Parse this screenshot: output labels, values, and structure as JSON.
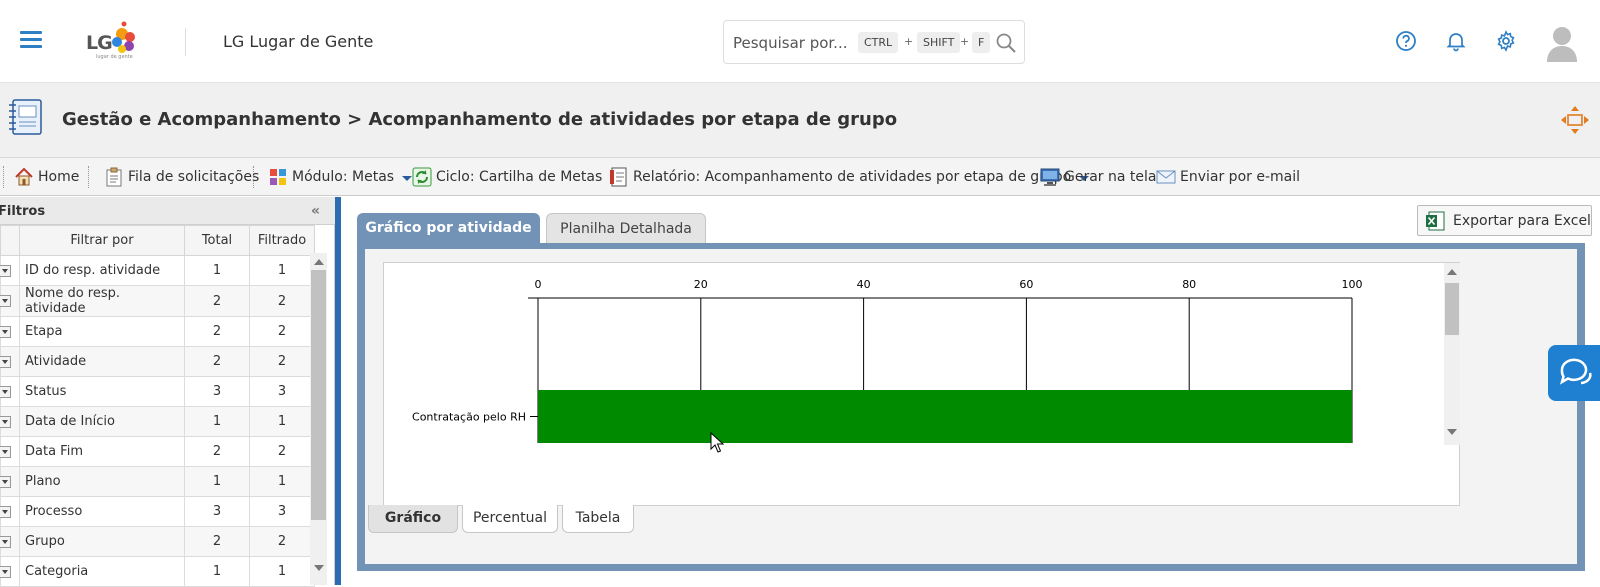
{
  "header": {
    "logo_text": "LG",
    "logo_tagline": "lugar de gente",
    "app_title": "LG Lugar de Gente",
    "search": {
      "placeholder": "Pesquisar por...",
      "keys": [
        "CTRL",
        "SHIFT",
        "F"
      ],
      "plus": "+"
    },
    "icons": [
      "help-icon",
      "bell-icon",
      "gear-icon",
      "user-avatar-icon"
    ],
    "accent_color": "#2e7fc4"
  },
  "titlebar": {
    "title": "Gestão e Acompanhamento > Acompanhamento de atividades por etapa de grupo"
  },
  "toolbar": {
    "home": "Home",
    "queue": "Fila de solicitações",
    "module": "Módulo: Metas",
    "cycle": "Ciclo: Cartilha de Metas",
    "report": "Relatório: Acompanhamento de atividades por etapa de grupo",
    "generate": "Gerar na tela",
    "email": "Enviar por e-mail"
  },
  "filters": {
    "title": "Filtros",
    "collapse": "«",
    "columns": [
      "Filtrar por",
      "Total",
      "Filtrado"
    ],
    "rows": [
      {
        "name": "ID do resp. atividade",
        "total": "1",
        "filtered": "1"
      },
      {
        "name": "Nome do resp. atividade",
        "total": "2",
        "filtered": "2"
      },
      {
        "name": "Etapa",
        "total": "2",
        "filtered": "2"
      },
      {
        "name": "Atividade",
        "total": "2",
        "filtered": "2"
      },
      {
        "name": "Status",
        "total": "3",
        "filtered": "3"
      },
      {
        "name": "Data de Início",
        "total": "1",
        "filtered": "1"
      },
      {
        "name": "Data Fim",
        "total": "2",
        "filtered": "2"
      },
      {
        "name": "Plano",
        "total": "1",
        "filtered": "1"
      },
      {
        "name": "Processo",
        "total": "3",
        "filtered": "3"
      },
      {
        "name": "Grupo",
        "total": "2",
        "filtered": "2"
      },
      {
        "name": "Categoria",
        "total": "1",
        "filtered": "1"
      }
    ]
  },
  "main": {
    "tabs": [
      {
        "label": "Gráfico por atividade",
        "active": true
      },
      {
        "label": "Planilha Detalhada",
        "active": false
      }
    ],
    "export_label": "Exportar para Excel",
    "bottom_tabs": [
      {
        "label": "Gráfico",
        "active": true
      },
      {
        "label": "Percentual",
        "active": false
      },
      {
        "label": "Tabela",
        "active": false
      }
    ]
  },
  "chart_data": {
    "type": "bar",
    "orientation": "horizontal",
    "categories": [
      "Contratação pelo RH"
    ],
    "values": [
      100
    ],
    "xlim": [
      0,
      100
    ],
    "ticks": [
      0,
      20,
      40,
      60,
      80,
      100
    ],
    "grid": true,
    "bar_color": "#008a00"
  }
}
